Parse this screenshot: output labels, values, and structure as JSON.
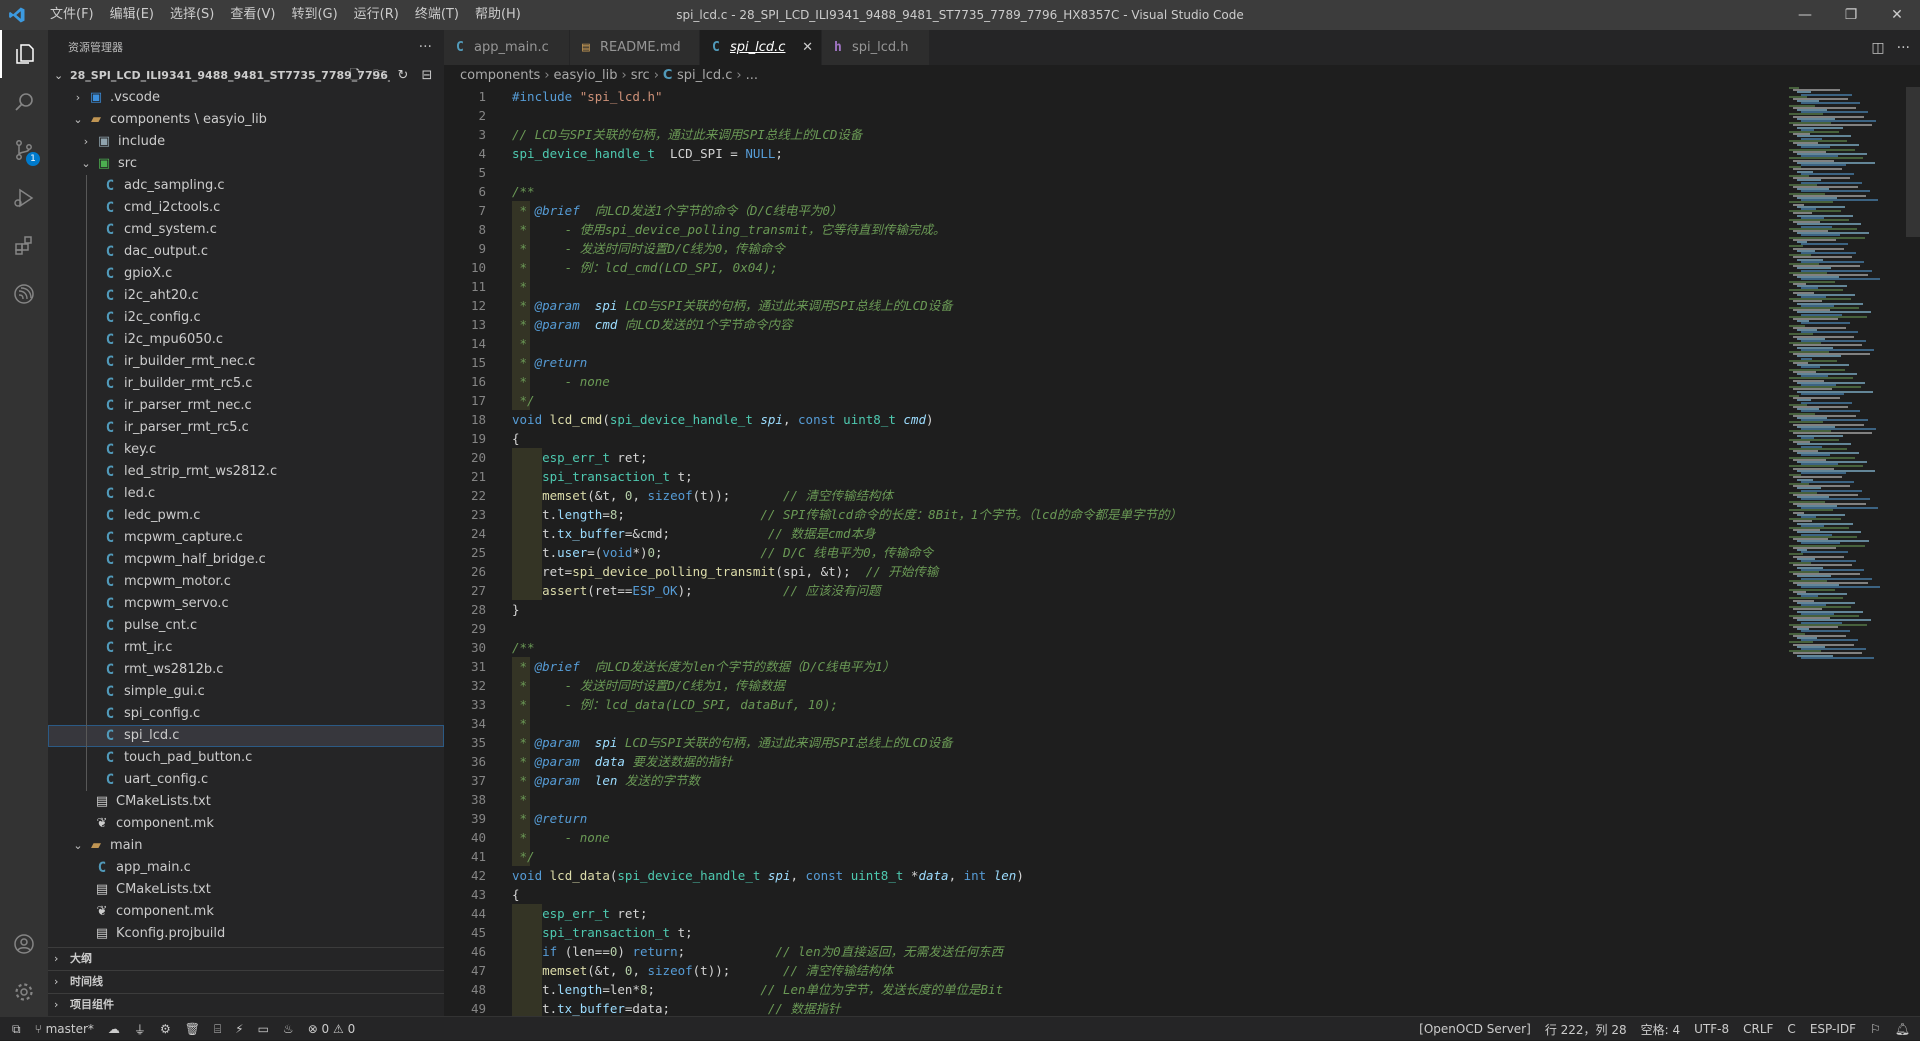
{
  "window": {
    "title": "spi_lcd.c - 28_SPI_LCD_ILI9341_9488_9481_ST7735_7789_7796_HX8357C - Visual Studio Code",
    "menu": [
      "文件(F)",
      "编辑(E)",
      "选择(S)",
      "查看(V)",
      "转到(G)",
      "运行(R)",
      "终端(T)",
      "帮助(H)"
    ],
    "controls": {
      "minimize": "—",
      "restore": "❐",
      "close": "✕"
    }
  },
  "activity_bar": {
    "scm_badge": "1"
  },
  "explorer": {
    "title": "资源管理器",
    "more": "···",
    "root": "28_SPI_LCD_ILI9341_9488_9481_ST7735_7789_7796_...",
    "tree": [
      {
        "label": ".vscode",
        "kind": "vsc",
        "depth": 1,
        "chev": "›"
      },
      {
        "label": "components \\ easyio_lib",
        "kind": "folder",
        "depth": 1,
        "chev": "⌄"
      },
      {
        "label": "include",
        "kind": "inc",
        "depth": 2,
        "chev": "›"
      },
      {
        "label": "src",
        "kind": "src",
        "depth": 2,
        "chev": "⌄"
      },
      {
        "label": "adc_sampling.c",
        "kind": "c",
        "depth": 3
      },
      {
        "label": "cmd_i2ctools.c",
        "kind": "c",
        "depth": 3
      },
      {
        "label": "cmd_system.c",
        "kind": "c",
        "depth": 3
      },
      {
        "label": "dac_output.c",
        "kind": "c",
        "depth": 3
      },
      {
        "label": "gpioX.c",
        "kind": "c",
        "depth": 3
      },
      {
        "label": "i2c_aht20.c",
        "kind": "c",
        "depth": 3
      },
      {
        "label": "i2c_config.c",
        "kind": "c",
        "depth": 3
      },
      {
        "label": "i2c_mpu6050.c",
        "kind": "c",
        "depth": 3
      },
      {
        "label": "ir_builder_rmt_nec.c",
        "kind": "c",
        "depth": 3
      },
      {
        "label": "ir_builder_rmt_rc5.c",
        "kind": "c",
        "depth": 3
      },
      {
        "label": "ir_parser_rmt_nec.c",
        "kind": "c",
        "depth": 3
      },
      {
        "label": "ir_parser_rmt_rc5.c",
        "kind": "c",
        "depth": 3
      },
      {
        "label": "key.c",
        "kind": "c",
        "depth": 3
      },
      {
        "label": "led_strip_rmt_ws2812.c",
        "kind": "c",
        "depth": 3
      },
      {
        "label": "led.c",
        "kind": "c",
        "depth": 3
      },
      {
        "label": "ledc_pwm.c",
        "kind": "c",
        "depth": 3
      },
      {
        "label": "mcpwm_capture.c",
        "kind": "c",
        "depth": 3
      },
      {
        "label": "mcpwm_half_bridge.c",
        "kind": "c",
        "depth": 3
      },
      {
        "label": "mcpwm_motor.c",
        "kind": "c",
        "depth": 3
      },
      {
        "label": "mcpwm_servo.c",
        "kind": "c",
        "depth": 3
      },
      {
        "label": "pulse_cnt.c",
        "kind": "c",
        "depth": 3
      },
      {
        "label": "rmt_ir.c",
        "kind": "c",
        "depth": 3
      },
      {
        "label": "rmt_ws2812b.c",
        "kind": "c",
        "depth": 3
      },
      {
        "label": "simple_gui.c",
        "kind": "c",
        "depth": 3
      },
      {
        "label": "spi_config.c",
        "kind": "c",
        "depth": 3
      },
      {
        "label": "spi_lcd.c",
        "kind": "c",
        "depth": 3,
        "selected": true
      },
      {
        "label": "touch_pad_button.c",
        "kind": "c",
        "depth": 3
      },
      {
        "label": "uart_config.c",
        "kind": "c",
        "depth": 3
      },
      {
        "label": "CMakeLists.txt",
        "kind": "file",
        "depth": 2
      },
      {
        "label": "component.mk",
        "kind": "mk",
        "depth": 2
      },
      {
        "label": "main",
        "kind": "folder",
        "depth": 1,
        "chev": "⌄"
      },
      {
        "label": "app_main.c",
        "kind": "c",
        "depth": 2
      },
      {
        "label": "CMakeLists.txt",
        "kind": "file",
        "depth": 2
      },
      {
        "label": "component.mk",
        "kind": "mk",
        "depth": 2
      },
      {
        "label": "Kconfig.projbuild",
        "kind": "file",
        "depth": 2
      }
    ],
    "sections": [
      "大纲",
      "时间线",
      "项目组件"
    ]
  },
  "tabs": [
    {
      "label": "app_main.c",
      "icon": "C"
    },
    {
      "label": "README.md",
      "icon": "▤"
    },
    {
      "label": "spi_lcd.c",
      "icon": "C",
      "active": true,
      "close": "✕"
    },
    {
      "label": "spi_lcd.h",
      "icon": "h"
    }
  ],
  "breadcrumbs": [
    "components",
    "easyio_lib",
    "src",
    "spi_lcd.c",
    "..."
  ],
  "code_lines": [
    [
      [
        "mac",
        "#include "
      ],
      [
        "s",
        "\"spi_lcd.h\""
      ]
    ],
    [],
    [
      [
        "cm",
        "// LCD与SPI关联的句柄，通过此来调用SPI总线上的LCD设备"
      ]
    ],
    [
      [
        "t",
        "spi_device_handle_t"
      ],
      [
        "",
        "  LCD_SPI = "
      ],
      [
        "k",
        "NULL"
      ],
      [
        "",
        ";"
      ]
    ],
    [],
    [
      [
        "cm",
        "/**"
      ]
    ],
    [
      [
        "cm",
        " * "
      ],
      [
        "ct",
        "@brief"
      ],
      [
        "cm",
        "  向LCD发送1个字节的命令（D/C线电平为0）"
      ]
    ],
    [
      [
        "cm",
        " *     - 使用spi_device_polling_transmit，它等待直到传输完成。"
      ]
    ],
    [
      [
        "cm",
        " *     - 发送时同时设置D/C线为0，传输命令"
      ]
    ],
    [
      [
        "cm",
        " *     - 例：lcd_cmd(LCD_SPI, 0x04);"
      ]
    ],
    [
      [
        "cm",
        " *"
      ]
    ],
    [
      [
        "cm",
        " * "
      ],
      [
        "ct",
        "@param"
      ],
      [
        "cm",
        "  "
      ],
      [
        "p",
        "spi"
      ],
      [
        "cm",
        " LCD与SPI关联的句柄，通过此来调用SPI总线上的LCD设备"
      ]
    ],
    [
      [
        "cm",
        " * "
      ],
      [
        "ct",
        "@param"
      ],
      [
        "cm",
        "  "
      ],
      [
        "p",
        "cmd"
      ],
      [
        "cm",
        " 向LCD发送的1个字节命令内容"
      ]
    ],
    [
      [
        "cm",
        " *"
      ]
    ],
    [
      [
        "cm",
        " * "
      ],
      [
        "ct",
        "@return"
      ]
    ],
    [
      [
        "cm",
        " *     - none"
      ]
    ],
    [
      [
        "cm",
        " */"
      ]
    ],
    [
      [
        "k",
        "void "
      ],
      [
        "f",
        "lcd_cmd"
      ],
      [
        "",
        "("
      ],
      [
        "t",
        "spi_device_handle_t "
      ],
      [
        "p",
        "spi"
      ],
      [
        "",
        ", "
      ],
      [
        "k",
        "const "
      ],
      [
        "t",
        "uint8_t "
      ],
      [
        "p",
        "cmd"
      ],
      [
        "",
        ")"
      ]
    ],
    [
      [
        "",
        "{"
      ]
    ],
    [
      [
        "",
        "    "
      ],
      [
        "t",
        "esp_err_t"
      ],
      [
        "",
        " ret;"
      ]
    ],
    [
      [
        "",
        "    "
      ],
      [
        "t",
        "spi_transaction_t"
      ],
      [
        "",
        " t;"
      ]
    ],
    [
      [
        "",
        "    "
      ],
      [
        "f",
        "memset"
      ],
      [
        "",
        "(&t, "
      ],
      [
        "n",
        "0"
      ],
      [
        "",
        ", "
      ],
      [
        "k",
        "sizeof"
      ],
      [
        "",
        "(t));       "
      ],
      [
        "cm",
        "// 清空传输结构体"
      ]
    ],
    [
      [
        "",
        "    t."
      ],
      [
        "v",
        "length"
      ],
      [
        "",
        "="
      ],
      [
        "n",
        "8"
      ],
      [
        "",
        ";                  "
      ],
      [
        "cm",
        "// SPI传输lcd命令的长度：8Bit，1个字节。（lcd的命令都是单字节的）"
      ]
    ],
    [
      [
        "",
        "    t."
      ],
      [
        "v",
        "tx_buffer"
      ],
      [
        "",
        "=&cmd;             "
      ],
      [
        "cm",
        "// 数据是cmd本身"
      ]
    ],
    [
      [
        "",
        "    t."
      ],
      [
        "v",
        "user"
      ],
      [
        "",
        "=("
      ],
      [
        "k",
        "void"
      ],
      [
        "",
        "*)"
      ],
      [
        "n",
        "0"
      ],
      [
        "",
        ";             "
      ],
      [
        "cm",
        "// D/C 线电平为0，传输命令"
      ]
    ],
    [
      [
        "",
        "    ret="
      ],
      [
        "f",
        "spi_device_polling_transmit"
      ],
      [
        "",
        "(spi, &t);  "
      ],
      [
        "cm",
        "// 开始传输"
      ]
    ],
    [
      [
        "",
        "    "
      ],
      [
        "f",
        "assert"
      ],
      [
        "",
        "(ret=="
      ],
      [
        "mac",
        "ESP_OK"
      ],
      [
        "",
        ");            "
      ],
      [
        "cm",
        "// 应该没有问题"
      ]
    ],
    [
      [
        "",
        "}"
      ]
    ],
    [],
    [
      [
        "cm",
        "/**"
      ]
    ],
    [
      [
        "cm",
        " * "
      ],
      [
        "ct",
        "@brief"
      ],
      [
        "cm",
        "  向LCD发送长度为len个字节的数据（D/C线电平为1）"
      ]
    ],
    [
      [
        "cm",
        " *     - 发送时同时设置D/C线为1，传输数据"
      ]
    ],
    [
      [
        "cm",
        " *     - 例：lcd_data(LCD_SPI, dataBuf, 10);"
      ]
    ],
    [
      [
        "cm",
        " *"
      ]
    ],
    [
      [
        "cm",
        " * "
      ],
      [
        "ct",
        "@param"
      ],
      [
        "cm",
        "  "
      ],
      [
        "p",
        "spi"
      ],
      [
        "cm",
        " LCD与SPI关联的句柄，通过此来调用SPI总线上的LCD设备"
      ]
    ],
    [
      [
        "cm",
        " * "
      ],
      [
        "ct",
        "@param"
      ],
      [
        "cm",
        "  "
      ],
      [
        "p",
        "data"
      ],
      [
        "cm",
        " 要发送数据的指针"
      ]
    ],
    [
      [
        "cm",
        " * "
      ],
      [
        "ct",
        "@param"
      ],
      [
        "cm",
        "  "
      ],
      [
        "p",
        "len"
      ],
      [
        "cm",
        " 发送的字节数"
      ]
    ],
    [
      [
        "cm",
        " *"
      ]
    ],
    [
      [
        "cm",
        " * "
      ],
      [
        "ct",
        "@return"
      ]
    ],
    [
      [
        "cm",
        " *     - none"
      ]
    ],
    [
      [
        "cm",
        " */"
      ]
    ],
    [
      [
        "k",
        "void "
      ],
      [
        "f",
        "lcd_data"
      ],
      [
        "",
        "("
      ],
      [
        "t",
        "spi_device_handle_t "
      ],
      [
        "p",
        "spi"
      ],
      [
        "",
        ", "
      ],
      [
        "k",
        "const "
      ],
      [
        "t",
        "uint8_t "
      ],
      [
        "",
        "*"
      ],
      [
        "p",
        "data"
      ],
      [
        "",
        ", "
      ],
      [
        "k",
        "int "
      ],
      [
        "p",
        "len"
      ],
      [
        "",
        ")"
      ]
    ],
    [
      [
        "",
        "{"
      ]
    ],
    [
      [
        "",
        "    "
      ],
      [
        "t",
        "esp_err_t"
      ],
      [
        "",
        " ret;"
      ]
    ],
    [
      [
        "",
        "    "
      ],
      [
        "t",
        "spi_transaction_t"
      ],
      [
        "",
        " t;"
      ]
    ],
    [
      [
        "",
        "    "
      ],
      [
        "k",
        "if"
      ],
      [
        "",
        " (len=="
      ],
      [
        "n",
        "0"
      ],
      [
        "",
        ") "
      ],
      [
        "k",
        "return"
      ],
      [
        "",
        ";            "
      ],
      [
        "cm",
        "// len为0直接返回，无需发送任何东西"
      ]
    ],
    [
      [
        "",
        "    "
      ],
      [
        "f",
        "memset"
      ],
      [
        "",
        "(&t, "
      ],
      [
        "n",
        "0"
      ],
      [
        "",
        ", "
      ],
      [
        "k",
        "sizeof"
      ],
      [
        "",
        "(t));       "
      ],
      [
        "cm",
        "// 清空传输结构体"
      ]
    ],
    [
      [
        "",
        "    t."
      ],
      [
        "v",
        "length"
      ],
      [
        "",
        "=len*"
      ],
      [
        "n",
        "8"
      ],
      [
        "",
        ";              "
      ],
      [
        "cm",
        "// Len单位为字节，发送长度的单位是Bit"
      ]
    ],
    [
      [
        "",
        "    t."
      ],
      [
        "v",
        "tx_buffer"
      ],
      [
        "",
        "=data;             "
      ],
      [
        "cm",
        "// 数据指针"
      ]
    ]
  ],
  "status": {
    "branch": "master*",
    "problems": "⊗ 0  ⚠ 0",
    "openocd": "[OpenOCD Server]",
    "position": "行 222，列 28",
    "indent": "空格: 4",
    "encoding": "UTF-8",
    "eol": "CRLF",
    "language": "C",
    "target": "ESP-IDF"
  }
}
